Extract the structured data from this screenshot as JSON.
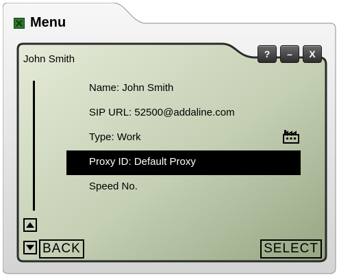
{
  "window": {
    "title": "Menu",
    "buttons": {
      "help": "?",
      "minimize": "–",
      "close": "X"
    }
  },
  "lcd": {
    "header": "John Smith",
    "items": [
      {
        "label": "Name: John Smith",
        "selected": false
      },
      {
        "label": "SIP URL: 52500@addaline.com",
        "selected": false
      },
      {
        "label": "Type: Work",
        "selected": false,
        "icon": "factory-icon"
      },
      {
        "label": "Proxy ID: Default Proxy",
        "selected": true
      },
      {
        "label": "Speed No.",
        "selected": false
      }
    ]
  },
  "softkeys": {
    "back": "BACK",
    "select": "SELECT"
  },
  "colors": {
    "lcd_light": "#e1e8d5",
    "lcd_dark": "#9eac8a",
    "frame": "#2b2b2b",
    "selection": "#000000"
  }
}
